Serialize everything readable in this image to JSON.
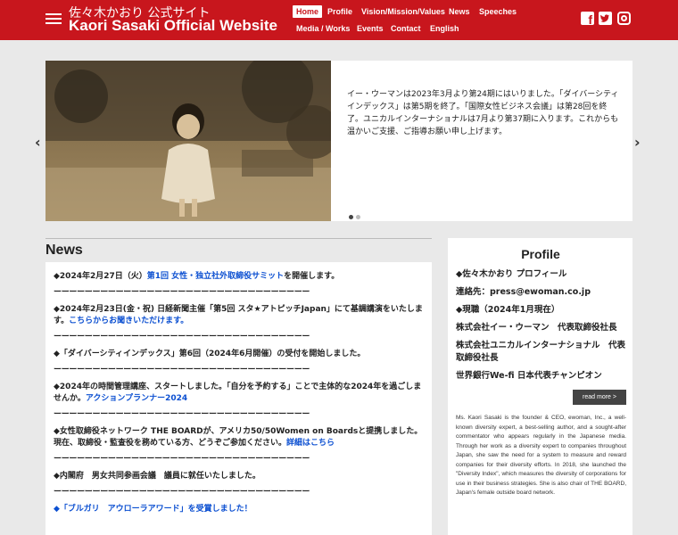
{
  "header": {
    "title_jp": "佐々木かおり 公式サイト",
    "title_en": "Kaori Sasaki Official Website",
    "nav": [
      {
        "label": "Home",
        "active": true
      },
      {
        "label": "Profile"
      },
      {
        "label": "Vision/Mission/Values"
      },
      {
        "label": "News"
      },
      {
        "label": "Speeches"
      },
      {
        "label": "Media / Works"
      },
      {
        "label": "Events"
      },
      {
        "label": "Contact"
      },
      {
        "label": "English"
      }
    ],
    "social": [
      "facebook-icon",
      "twitter-icon",
      "instagram-icon"
    ],
    "colors": {
      "brand": "#c8161d"
    }
  },
  "slider": {
    "text": "イー・ウーマンは2023年3月より第24期にはいりました。「ダイバーシティインデックス」は第5期を終了。「国際女性ビジネス会議」は第28回を終了。ユニカルインターナショナルは7月より第37期に入ります。これからも温かいご支援、ご指導お願い申し上げます。",
    "active_slide": 1,
    "slide_count": 2
  },
  "news": {
    "title": "News",
    "separator": "ーーーーーーーーーーーーーーーーーーーーーーーーーーーーーーーーー",
    "items": [
      {
        "text": "◆2024年2月27日（火）",
        "link": "第1回 女性・独立社外取締役サミット",
        "after": "を開催します。"
      },
      {
        "text": "◆2024年2月23日(金・祝) 日経新聞主催「第5回 スタ★アトピッチJapan」にて基調講演をいたします。",
        "link": "こちらからお聞きいただけます。",
        "after": ""
      },
      {
        "text": "◆「ダイバーシティインデックス」第6回（2024年6月開催）の受付を開始しました。",
        "link": "",
        "after": ""
      },
      {
        "text": "◆2024年の時間管理講座、スタートしました。「自分を予約する」ことで主体的な2024年を過ごしませんか。",
        "link": "アクションプランナー2024",
        "after": ""
      },
      {
        "text": "◆女性取締役ネットワーク THE BOARDが、アメリカ50/50Women on Boardsと提携しました。現在、取締役・監査役を務めている方、どうぞご参加ください。",
        "link": "詳細はこちら",
        "after": ""
      },
      {
        "text": "◆内閣府　男女共同参画会議　議員に就任いたしました。",
        "link": "",
        "after": ""
      },
      {
        "text": "",
        "link": "◆「ブルガリ　アウローラアワード」を受賞しました！",
        "after": ""
      }
    ]
  },
  "profile": {
    "title": "Profile",
    "lines": [
      "◆佐々木かおり プロフィール",
      "連絡先：press@ewoman.co.jp",
      "◆現職（2024年1月現在）",
      "株式会社イー・ウーマン　代表取締役社長",
      "株式会社ユニカルインターナショナル　代表取締役社長",
      "世界銀行We-fi 日本代表チャンピオン"
    ],
    "read_more": "read more >",
    "bio_en": "Ms. Kaori Sasaki is the founder & CEO, ewoman, Inc., a well-known diversity expert, a best-selling author, and a sought-after commentator who appears regularly in the Japanese media. Through her work as a diversity expert to companies throughout Japan, she saw the need for a system to measure and reward companies for their diversity efforts. In 2018, she launched the \"Diversity Index\", which measures the diversity of corporations for use in their business strategies. She is also chair of THE BOARD, Japan's female outside board network."
  }
}
